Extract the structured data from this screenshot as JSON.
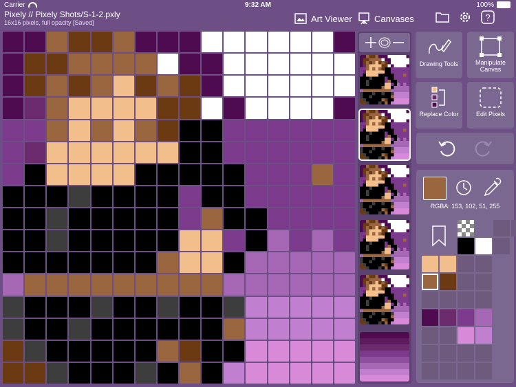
{
  "status": {
    "carrier": "Carrier",
    "time": "9:32 AM",
    "battery": "100%"
  },
  "header": {
    "title": "Pixely // Pixely Shots/S-1-2.pxly",
    "subtitle": "16x16 pixels, full opacity [Saved]",
    "art_viewer": "Art Viewer",
    "canvases": "Canvases"
  },
  "tools": {
    "drawing_tools": "Drawing Tools",
    "manipulate_canvas": "Manipulate Canvas",
    "replace_color": "Replace Color",
    "edit_pixels": "Edit Pixels"
  },
  "palette": {
    "current_color": "#99663f",
    "rgba_label": "RGBA: 153, 102, 51, 255"
  },
  "colors": {
    "k": "#000000",
    "D": "#3d3d3d",
    "w": "#ffffff",
    "s": "#f2bf8c",
    "b": "#99663f",
    "n": "#6b3a12",
    "p": "#4f0b4f",
    "m": "#6b2a6b",
    "v": "#7b3a8b",
    "l": "#a667b5",
    "q": "#c07fcf",
    "r": "#d88ad8",
    "g": "#6d5a7d"
  },
  "canvas_rows": [
    "ppbnnbpppwwwwwwp",
    "pnnbbbbwppwwwwww",
    "pnbnbsnbnpwwwwww",
    "pmbssssnnwpwwwwp",
    "vvbsbsbnkkvvvvvv",
    "vmsssssskkvvvvvv",
    "vksssskkkkkvvvbv",
    "kkkDkkkkvkkvvvvv",
    "kkDkkkkkvbkkvvvv",
    "kkDkkkkkssvklvlv",
    "kkkkkkkbssklllll",
    "lbbbbbbbbbllllll",
    "DkkkDkkDkkDqqqqq",
    "DkkDkkkkkkbqqqqq",
    "nDkkkkkbnkkrrrrr",
    "nnDkkkDkbkqrrrrr"
  ],
  "swatches": [
    [
      "",
      "",
      "",
      ""
    ],
    [
      "D",
      "k",
      "w",
      ""
    ],
    [
      "s",
      "s",
      "",
      ""
    ],
    [
      "b",
      "n",
      "",
      ""
    ],
    [
      "",
      "",
      "",
      ""
    ],
    [
      "p",
      "m",
      "v",
      "l"
    ],
    [
      "",
      "",
      "r",
      "q"
    ],
    [
      "",
      "",
      "",
      ""
    ],
    [
      "",
      "",
      "",
      ""
    ]
  ]
}
